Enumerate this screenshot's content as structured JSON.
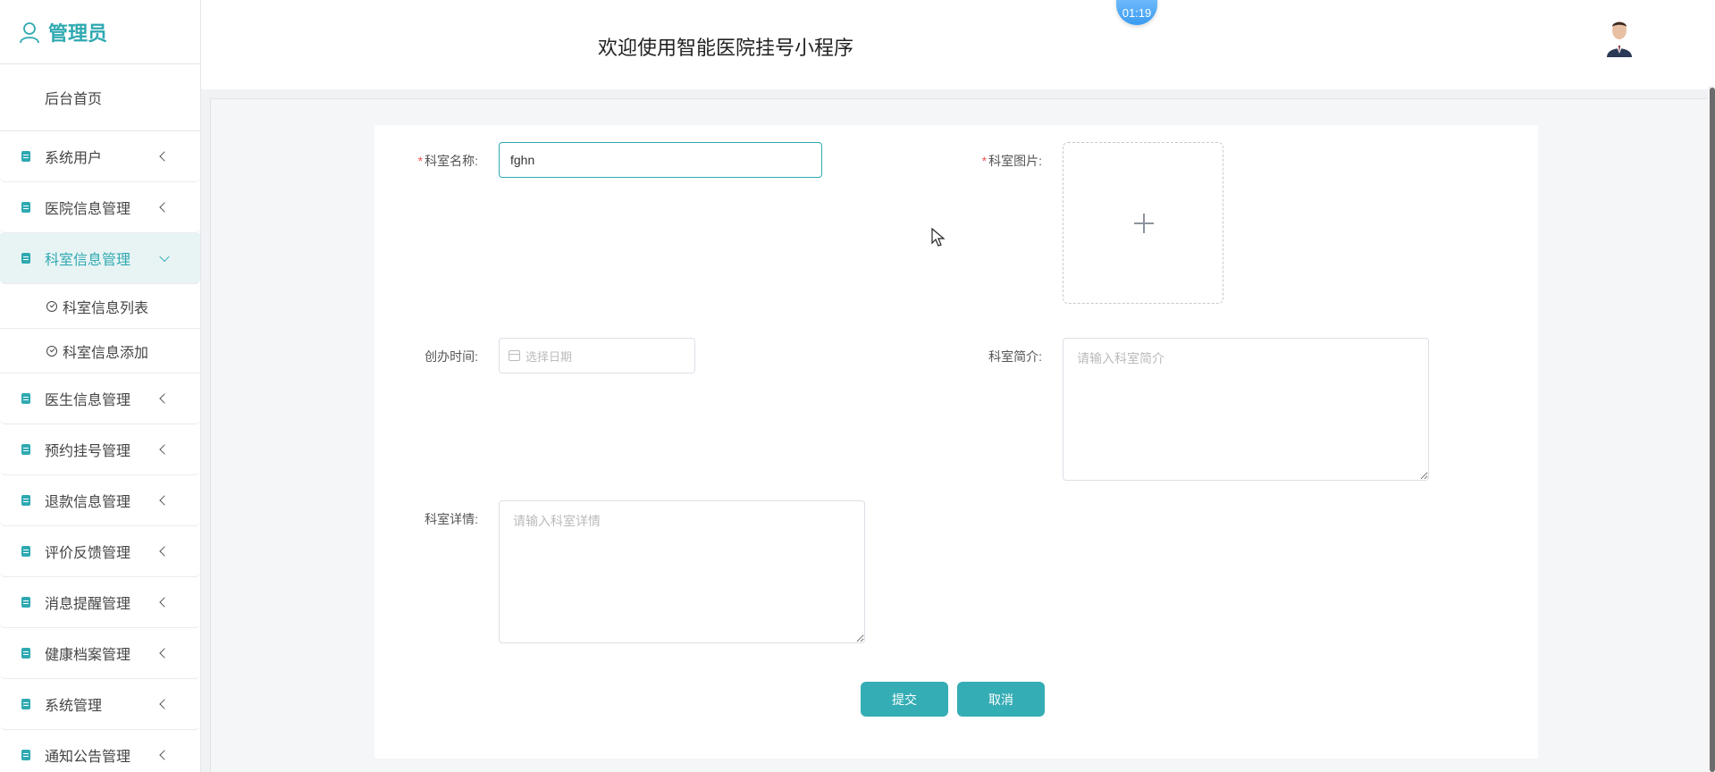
{
  "brand": {
    "title": "管理员"
  },
  "header": {
    "title": "欢迎使用智能医院挂号小程序",
    "timer": "01:19"
  },
  "sidebar": {
    "home": "后台首页",
    "items": [
      {
        "label": "系统用户"
      },
      {
        "label": "医院信息管理"
      },
      {
        "label": "科室信息管理",
        "active": true
      },
      {
        "label": "医生信息管理"
      },
      {
        "label": "预约挂号管理"
      },
      {
        "label": "退款信息管理"
      },
      {
        "label": "评价反馈管理"
      },
      {
        "label": "消息提醒管理"
      },
      {
        "label": "健康档案管理"
      },
      {
        "label": "系统管理"
      },
      {
        "label": "通知公告管理"
      }
    ],
    "subitems": [
      {
        "label": "科室信息列表"
      },
      {
        "label": "科室信息添加"
      }
    ]
  },
  "form": {
    "name_label": "科室名称:",
    "name_value": "fghn",
    "image_label": "科室图片:",
    "date_label": "创办时间:",
    "date_placeholder": "选择日期",
    "intro_label": "科室简介:",
    "intro_placeholder": "请输入科室简介",
    "detail_label": "科室详情:",
    "detail_placeholder": "请输入科室详情",
    "required_mark": "*",
    "submit_label": "提交",
    "cancel_label": "取消"
  },
  "colors": {
    "accent": "#2fa9b1",
    "button": "#35adb5"
  }
}
